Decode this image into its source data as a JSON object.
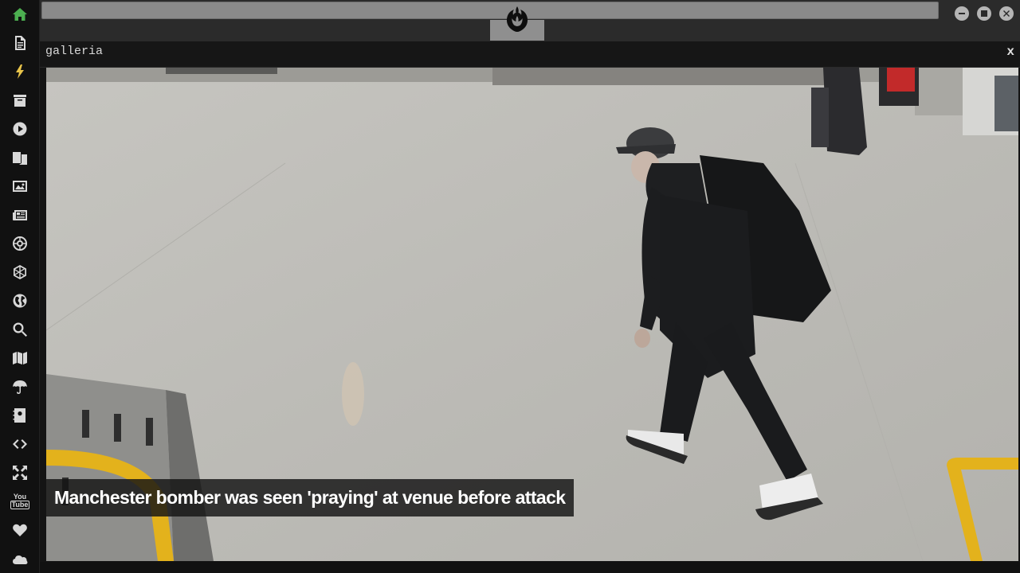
{
  "sidebar": {
    "items": [
      {
        "icon": "home-icon",
        "active": true
      },
      {
        "icon": "document-icon"
      },
      {
        "icon": "lightning-icon"
      },
      {
        "icon": "archive-icon"
      },
      {
        "icon": "play-circle-icon"
      },
      {
        "icon": "translate-icon"
      },
      {
        "icon": "image-icon"
      },
      {
        "icon": "newspaper-icon"
      },
      {
        "icon": "galactic-empire-icon"
      },
      {
        "icon": "hexagon-network-icon"
      },
      {
        "icon": "globe-icon"
      },
      {
        "icon": "search-icon"
      },
      {
        "icon": "map-icon"
      },
      {
        "icon": "umbrella-icon"
      },
      {
        "icon": "contact-book-icon"
      },
      {
        "icon": "code-icon"
      },
      {
        "icon": "expand-icon"
      },
      {
        "icon": "youtube-icon",
        "label_top": "You",
        "label_bottom": "Tube"
      },
      {
        "icon": "heart-icon"
      },
      {
        "icon": "cloud-icon"
      }
    ],
    "active_color": "#4caf50"
  },
  "window": {
    "logo": "rebel-alliance-icon",
    "controls": [
      "minimize-icon",
      "maximize-icon",
      "close-icon"
    ]
  },
  "panel": {
    "title": "galleria",
    "close_label": "x"
  },
  "photo": {
    "caption": "Manchester bomber was seen 'praying' at venue before attack"
  }
}
